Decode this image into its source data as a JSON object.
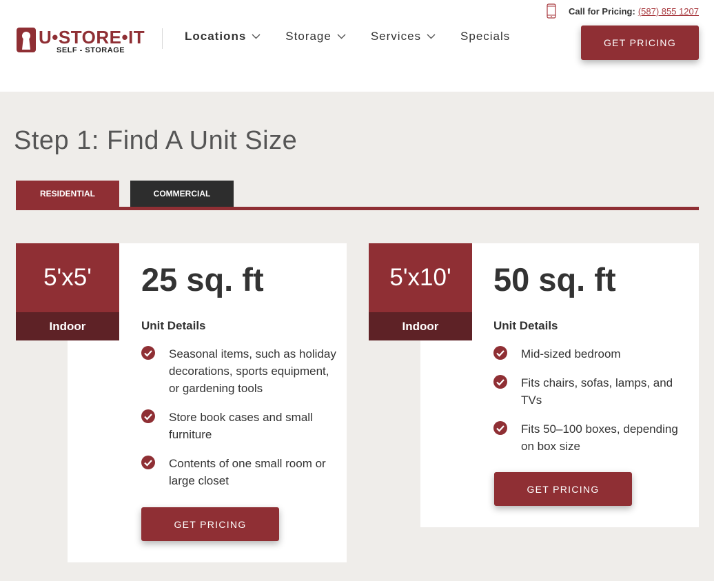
{
  "header": {
    "logo": {
      "main": "U•STORE•IT",
      "sub": "SELF - STORAGE"
    },
    "nav": [
      {
        "label": "Locations",
        "dropdown": true
      },
      {
        "label": "Storage",
        "dropdown": true
      },
      {
        "label": "Services",
        "dropdown": true
      },
      {
        "label": "Specials",
        "dropdown": false
      }
    ],
    "call_label": "Call for Pricing:",
    "phone": "(587) 855 1207",
    "cta": "GET PRICING"
  },
  "step_title": "Step 1: Find A Unit Size",
  "tabs": [
    {
      "label": "RESIDENTIAL"
    },
    {
      "label": "COMMERCIAL"
    }
  ],
  "units": [
    {
      "dimensions": "5'x5'",
      "type": "Indoor",
      "area": "25 sq. ft",
      "details_heading": "Unit Details",
      "details": [
        "Seasonal items, such as holiday decorations, sports equipment, or gardening tools",
        "Store book cases and small furniture",
        "Contents of one small room or large closet"
      ],
      "cta": "GET PRICING"
    },
    {
      "dimensions": "5'x10'",
      "type": "Indoor",
      "area": "50 sq. ft",
      "details_heading": "Unit Details",
      "details": [
        "Mid-sized bedroom",
        "Fits chairs, sofas, lamps, and TVs",
        "Fits 50–100 boxes, depending on box size"
      ],
      "cta": "GET PRICING"
    }
  ],
  "colors": {
    "brand": "#8f2f34",
    "brand_dark": "#5e2226",
    "tab_dark": "#2d2d2d",
    "page_bg": "#efedea"
  }
}
